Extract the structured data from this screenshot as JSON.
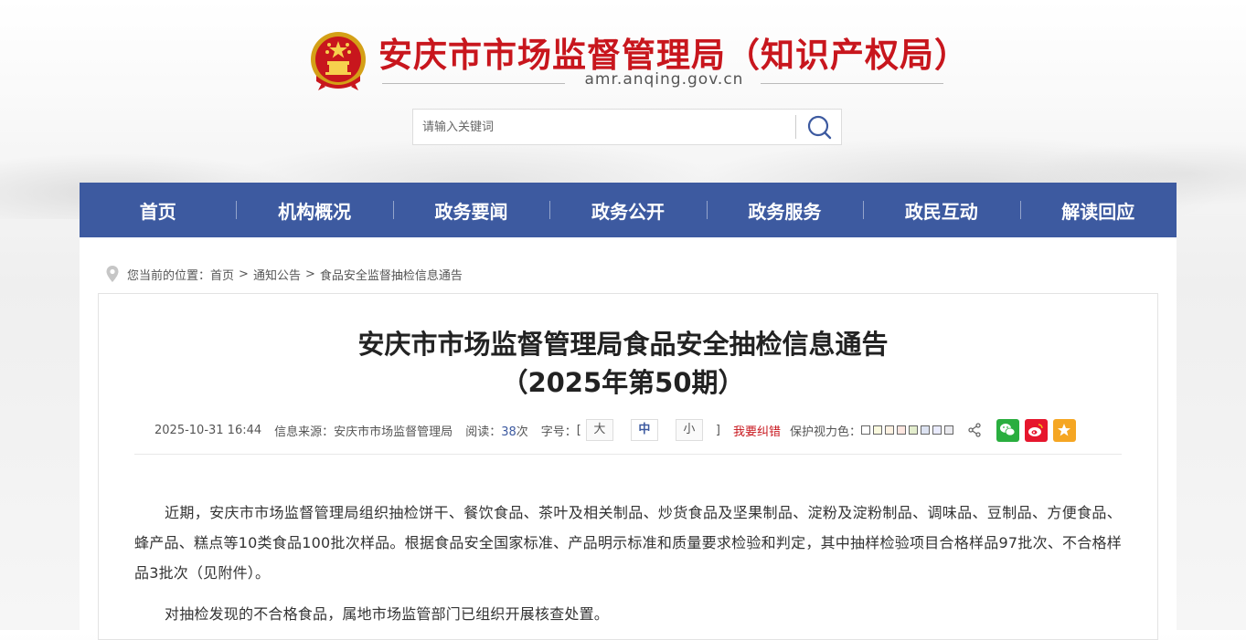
{
  "header": {
    "site_title": "安庆市市场监督管理局（知识产权局）",
    "domain": "amr.anqing.gov.cn",
    "search_placeholder": "请输入关键词"
  },
  "nav": {
    "items": [
      "首页",
      "机构概况",
      "政务要闻",
      "政务公开",
      "政务服务",
      "政民互动",
      "解读回应"
    ]
  },
  "breadcrumb": {
    "prefix": "您当前的位置：",
    "items": [
      "首页",
      "通知公告",
      "食品安全监督抽检信息通告"
    ],
    "separator": ">"
  },
  "article": {
    "title_line1": "安庆市市场监督管理局食品安全抽检信息通告",
    "title_line2": "（2025年第50期）",
    "meta": {
      "datetime": "2025-10-31 16:44",
      "source_label": "信息来源：",
      "source": "安庆市市场监督管理局",
      "views_label": "阅读：",
      "views": "38",
      "views_unit": "次",
      "font_label": "字号：",
      "font_open": "[",
      "font_large": "大",
      "font_medium": "中",
      "font_small": "小",
      "font_close": "]",
      "report_error": "我要纠错",
      "eye_care_label": "保护视力色："
    },
    "paragraphs": [
      "近期，安庆市市场监督管理局组织抽检饼干、餐饮食品、茶叶及相关制品、炒货食品及坚果制品、淀粉及淀粉制品、调味品、豆制品、方便食品、蜂产品、糕点等10类食品100批次样品。根据食品安全国家标准、产品明示标准和质量要求检验和判定，其中抽样检验项目合格样品97批次、不合格样品3批次（见附件）。",
      "对抽检发现的不合格食品，属地市场监管部门已组织开展核查处置。"
    ]
  },
  "colors": {
    "brand_red": "#c8161d",
    "nav_blue": "#3d5aa0",
    "eye_care_swatches": [
      "#ffffff",
      "#faf9de",
      "#fff2e2",
      "#fde6e0",
      "#e3edcd",
      "#dce2f1",
      "#e9ebfe",
      "#eaeaef"
    ],
    "wechat": "#2aae3f",
    "weibo": "#e6162d",
    "qzone": "#f5a623"
  },
  "icons": {
    "emblem": "national-emblem-icon",
    "search": "search-icon",
    "location": "location-pin-icon",
    "share": "share-icon",
    "wechat": "wechat-icon",
    "weibo": "weibo-icon",
    "qzone": "qzone-star-icon"
  }
}
